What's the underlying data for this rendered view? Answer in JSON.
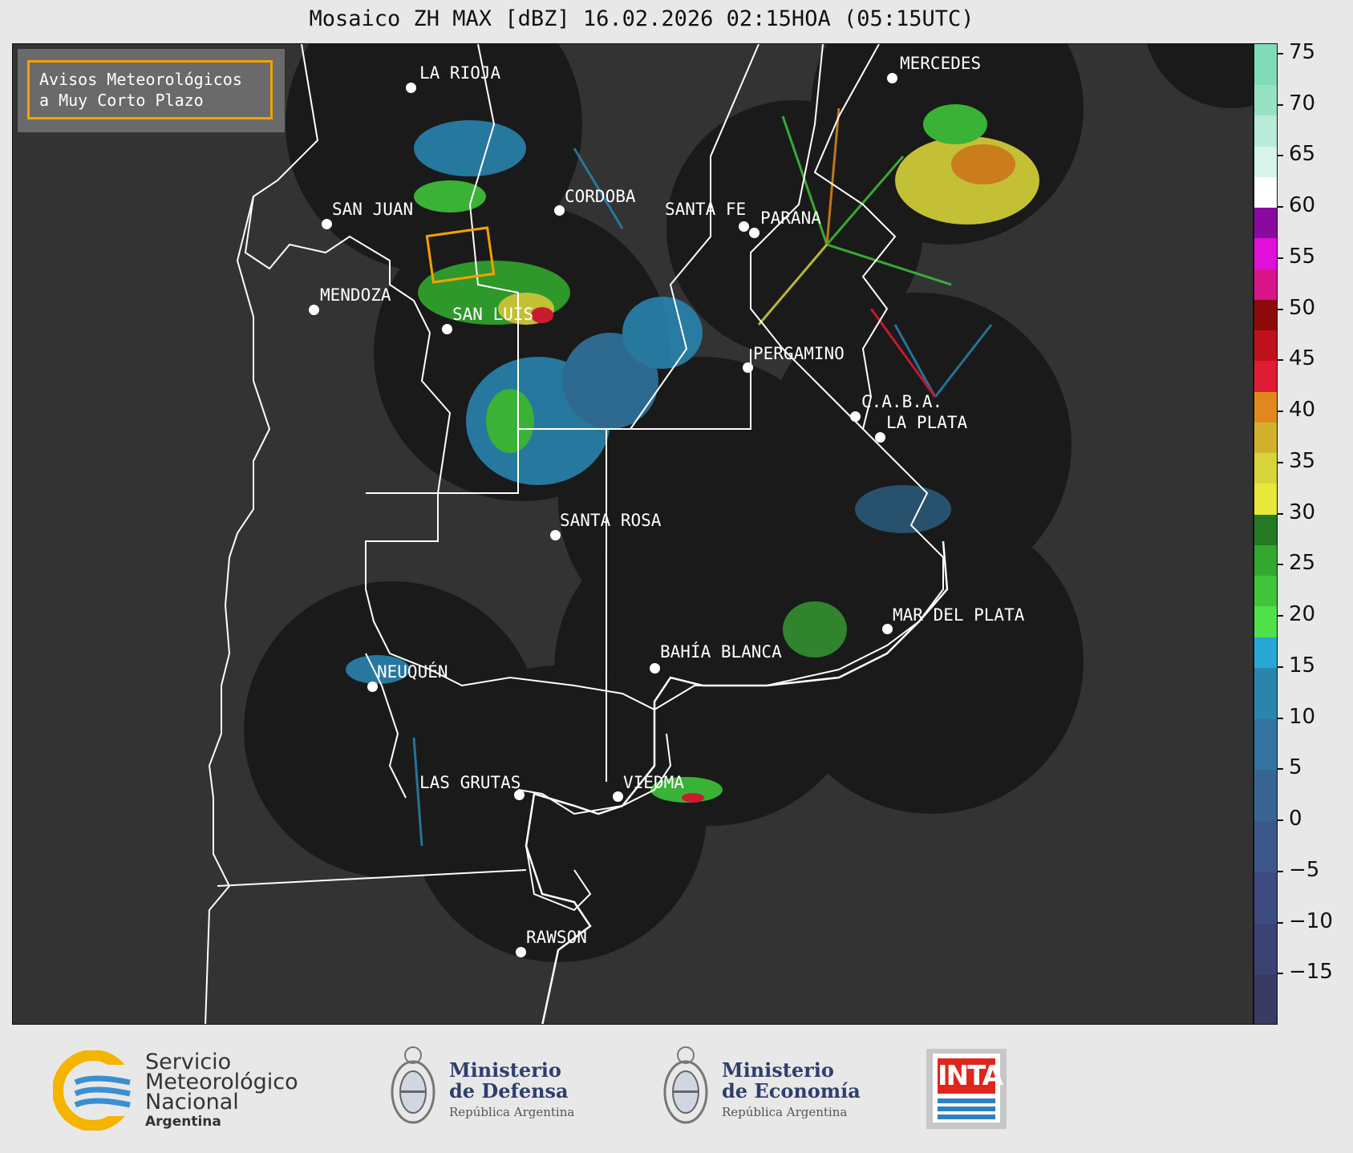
{
  "title": "Mosaico ZH MAX [dBZ] 16.02.2026 02:15HOA (05:15UTC)",
  "badge": {
    "line1": "Avisos Meteorológicos",
    "line2": "a Muy Corto Plazo"
  },
  "colors": {
    "map_background": "#333333",
    "radar_coverage": "#1a1a1a",
    "boundaries": "#ffffff",
    "badge_border": "#f5a000"
  },
  "cities": [
    {
      "name": "LA RIOJA"
    },
    {
      "name": "MERCEDES"
    },
    {
      "name": "CORDOBA"
    },
    {
      "name": "SAN JUAN"
    },
    {
      "name": "SANTA FE"
    },
    {
      "name": "PARANA"
    },
    {
      "name": "MENDOZA"
    },
    {
      "name": "SAN LUIS"
    },
    {
      "name": "PERGAMINO"
    },
    {
      "name": "C.A.B.A."
    },
    {
      "name": "LA PLATA"
    },
    {
      "name": "SANTA ROSA"
    },
    {
      "name": "MAR DEL PLATA"
    },
    {
      "name": "BAHÍA BLANCA"
    },
    {
      "name": "NEUQUÉN"
    },
    {
      "name": "LAS GRUTAS"
    },
    {
      "name": "VIEDMA"
    },
    {
      "name": "RAWSON"
    }
  ],
  "colorbar": {
    "unit": "dBZ",
    "ticks": [
      "75",
      "70",
      "65",
      "60",
      "55",
      "50",
      "45",
      "40",
      "35",
      "30",
      "25",
      "20",
      "15",
      "10",
      "5",
      "0",
      "−5",
      "−10",
      "−15"
    ],
    "range": [
      -20,
      76
    ],
    "segments": [
      {
        "from": -20,
        "to": -15,
        "color": "#3a3a66"
      },
      {
        "from": -15,
        "to": -10,
        "color": "#3b4274"
      },
      {
        "from": -10,
        "to": -5,
        "color": "#3c4b80"
      },
      {
        "from": -5,
        "to": 0,
        "color": "#3b568a"
      },
      {
        "from": 0,
        "to": 5,
        "color": "#386594"
      },
      {
        "from": 5,
        "to": 10,
        "color": "#32749f"
      },
      {
        "from": 10,
        "to": 15,
        "color": "#2a84ae"
      },
      {
        "from": 15,
        "to": 18,
        "color": "#28a7d6"
      },
      {
        "from": 18,
        "to": 21,
        "color": "#4fe04a"
      },
      {
        "from": 21,
        "to": 24,
        "color": "#3fc43a"
      },
      {
        "from": 24,
        "to": 27,
        "color": "#32a82e"
      },
      {
        "from": 27,
        "to": 30,
        "color": "#237a22"
      },
      {
        "from": 30,
        "to": 33,
        "color": "#e8e83a"
      },
      {
        "from": 33,
        "to": 36,
        "color": "#d8d43a"
      },
      {
        "from": 36,
        "to": 39,
        "color": "#d2b22c"
      },
      {
        "from": 39,
        "to": 42,
        "color": "#e0881e"
      },
      {
        "from": 42,
        "to": 45,
        "color": "#e01c34"
      },
      {
        "from": 45,
        "to": 48,
        "color": "#c0101c"
      },
      {
        "from": 48,
        "to": 51,
        "color": "#8c0a0a"
      },
      {
        "from": 51,
        "to": 54,
        "color": "#d8168a"
      },
      {
        "from": 54,
        "to": 57,
        "color": "#e010d8"
      },
      {
        "from": 57,
        "to": 60,
        "color": "#8a0aa0"
      },
      {
        "from": 60,
        "to": 63,
        "color": "#ffffff"
      },
      {
        "from": 63,
        "to": 66,
        "color": "#d8f4e8"
      },
      {
        "from": 66,
        "to": 69,
        "color": "#b8ecd8"
      },
      {
        "from": 69,
        "to": 72,
        "color": "#98e2c4"
      },
      {
        "from": 72,
        "to": 76,
        "color": "#80dcb8"
      }
    ]
  },
  "footer": {
    "smn": {
      "line1": "Servicio",
      "line2": "Meteorológico",
      "line3": "Nacional",
      "line4": "Argentina"
    },
    "defensa": {
      "line1": "Ministerio",
      "line2": "de Defensa",
      "sub": "República Argentina"
    },
    "economia": {
      "line1": "Ministerio",
      "line2": "de Economía",
      "sub": "República Argentina"
    },
    "inta": {
      "word": "INTA"
    }
  }
}
